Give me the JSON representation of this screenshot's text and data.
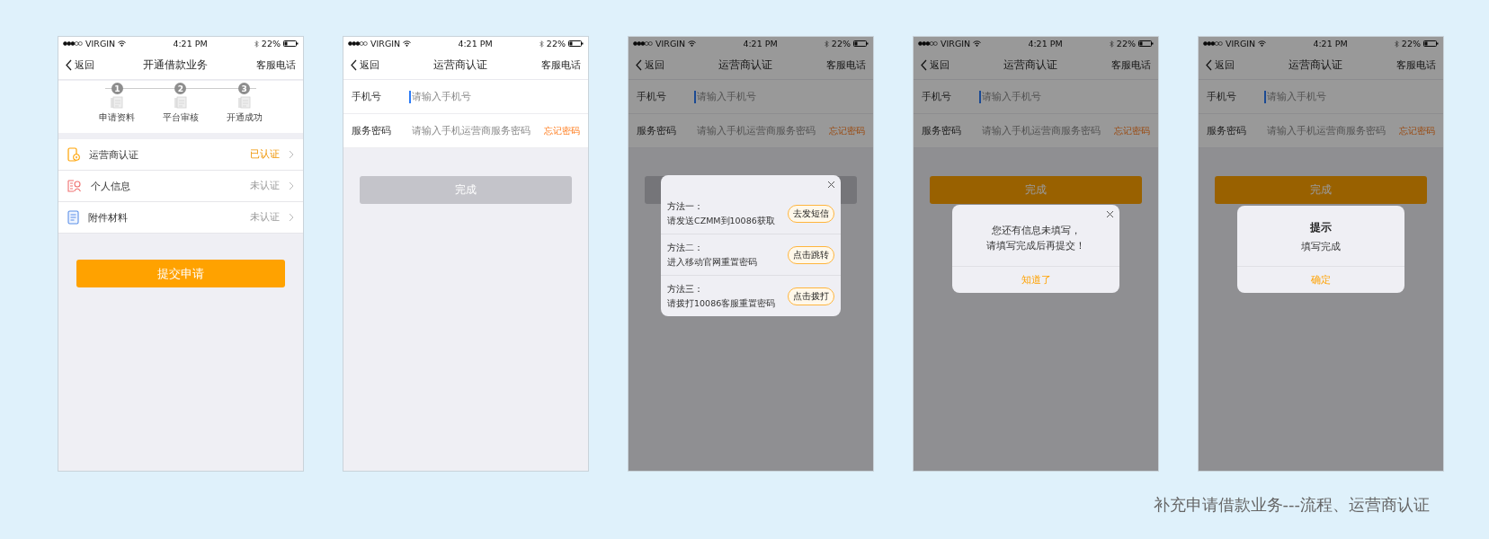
{
  "screens": [
    {
      "kind": "apply",
      "dimmed": false,
      "status": {
        "carrier": "VIRGIN",
        "time": "4:21 PM",
        "battery": "22%"
      },
      "nav": {
        "back": "返回",
        "title": "开通借款业务",
        "action": "客服电话"
      },
      "steps": [
        {
          "number": "1",
          "label": "申请资料"
        },
        {
          "number": "2",
          "label": "平台审核"
        },
        {
          "number": "3",
          "label": "开通成功"
        }
      ],
      "items": [
        {
          "kind": "carrier",
          "label": "运营商认证",
          "status": "已认证",
          "verified": true
        },
        {
          "kind": "personal",
          "label": "个人信息",
          "status": "未认证",
          "verified": false
        },
        {
          "kind": "attachment",
          "label": "附件材料",
          "status": "未认证",
          "verified": false
        }
      ],
      "submit": "提交申请"
    },
    {
      "kind": "auth",
      "dimmed": false,
      "status": {
        "carrier": "VIRGIN",
        "time": "4:21 PM",
        "battery": "22%"
      },
      "nav": {
        "back": "返回",
        "title": "运营商认证",
        "action": "客服电话"
      },
      "fields": [
        {
          "label": "手机号",
          "placeholder": "请输入手机号",
          "focused": true
        },
        {
          "label": "服务密码",
          "placeholder": "请输入手机运营商服务密码",
          "focused": false,
          "link": "忘记密码"
        }
      ],
      "done": {
        "label": "完成",
        "enabled": false
      }
    },
    {
      "kind": "auth",
      "dimmed": true,
      "status": {
        "carrier": "VIRGIN",
        "time": "4:21 PM",
        "battery": "22%"
      },
      "nav": {
        "back": "返回",
        "title": "运营商认证",
        "action": "客服电话"
      },
      "fields": [
        {
          "label": "手机号",
          "placeholder": "请输入手机号",
          "focused": true
        },
        {
          "label": "服务密码",
          "placeholder": "请输入手机运营商服务密码",
          "focused": false,
          "link": "忘记密码"
        }
      ],
      "done": {
        "enabled": false
      },
      "dialog": {
        "kind": "methods",
        "methods": [
          {
            "title": "方法一：",
            "detail": "请发送CZMM到10086获取",
            "action": "去发短信"
          },
          {
            "title": "方法二：",
            "detail": "进入移动官网重置密码",
            "action": "点击跳转"
          },
          {
            "title": "方法三：",
            "detail": "请拨打10086客服重置密码",
            "action": "点击拨打"
          }
        ]
      }
    },
    {
      "kind": "auth",
      "dimmed": true,
      "status": {
        "carrier": "VIRGIN",
        "time": "4:21 PM",
        "battery": "22%"
      },
      "nav": {
        "back": "返回",
        "title": "运营商认证",
        "action": "客服电话"
      },
      "fields": [
        {
          "label": "手机号",
          "placeholder": "请输入手机号",
          "focused": true
        },
        {
          "label": "服务密码",
          "placeholder": "请输入手机运营商服务密码",
          "focused": false,
          "link": "忘记密码"
        }
      ],
      "done": {
        "label": "完成",
        "enabled": true
      },
      "dialog": {
        "kind": "alert",
        "lines": [
          "您还有信息未填写，",
          "请填写完成后再提交！"
        ],
        "button": "知道了"
      }
    },
    {
      "kind": "auth",
      "dimmed": true,
      "status": {
        "carrier": "VIRGIN",
        "time": "4:21 PM",
        "battery": "22%"
      },
      "nav": {
        "back": "返回",
        "title": "运营商认证",
        "action": "客服电话"
      },
      "fields": [
        {
          "label": "手机号",
          "placeholder": "请输入手机号",
          "focused": true
        },
        {
          "label": "服务密码",
          "placeholder": "请输入手机运营商服务密码",
          "focused": false,
          "link": "忘记密码"
        }
      ],
      "done": {
        "label": "完成",
        "enabled": true
      },
      "dialog": {
        "kind": "prompt",
        "title": "提示",
        "message": "填写完成",
        "button": "确定"
      }
    }
  ],
  "caption": "补充申请借款业务---流程、运营商认证"
}
